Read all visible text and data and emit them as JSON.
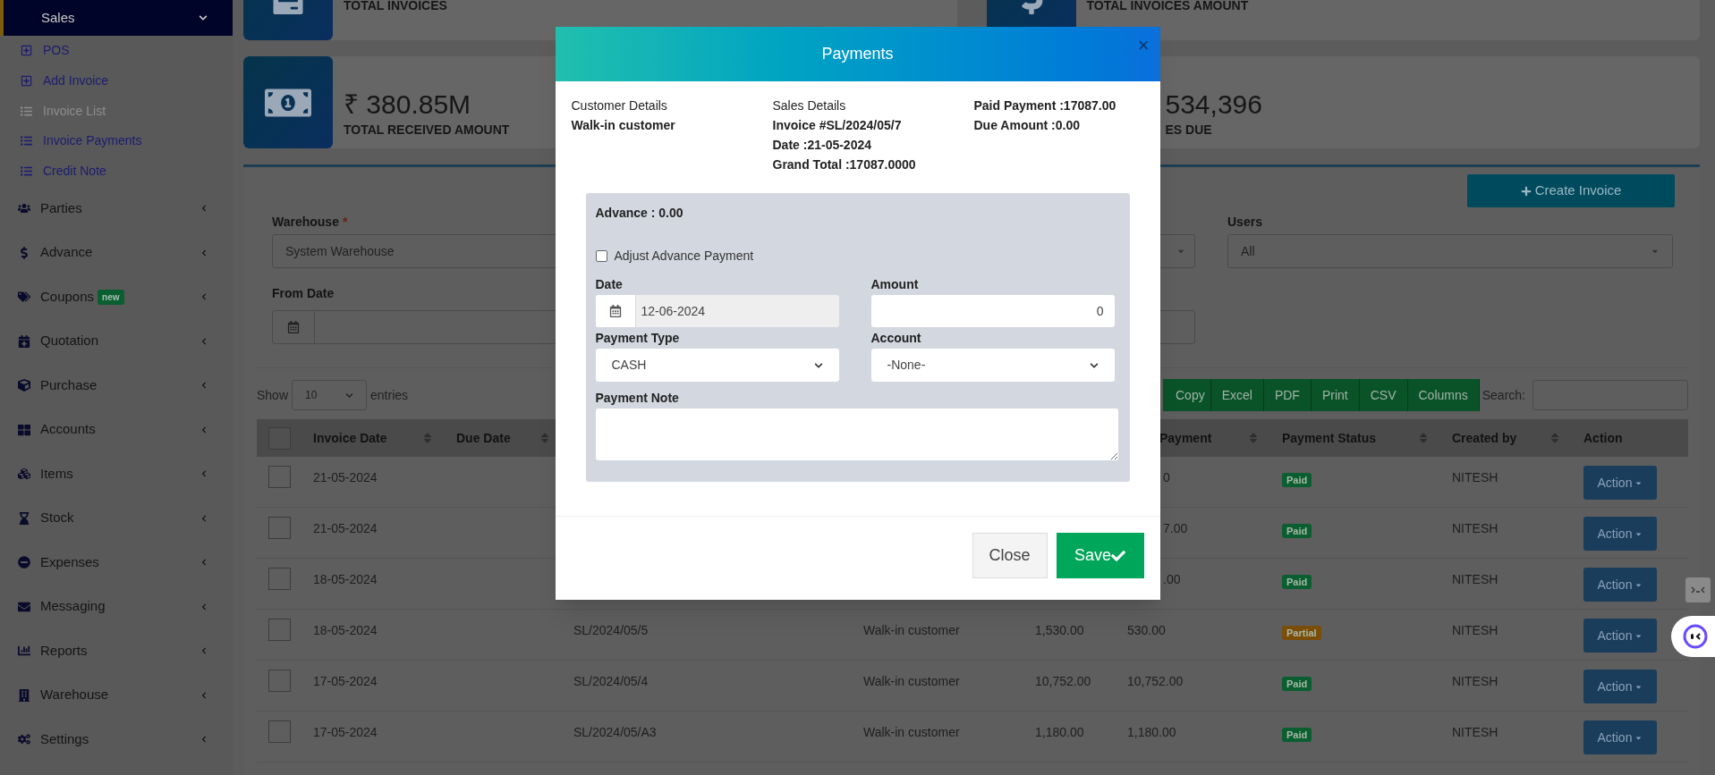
{
  "sidebar": {
    "section": {
      "label": "Sales",
      "expanded": true
    },
    "sub_items": [
      {
        "label": "POS",
        "selected": false
      },
      {
        "label": "Add Invoice",
        "selected": false
      },
      {
        "label": "Invoice List",
        "selected": true
      },
      {
        "label": "Invoice Payments",
        "selected": false
      },
      {
        "label": "Credit Note",
        "selected": false
      }
    ],
    "items": [
      {
        "label": "Parties",
        "expanded": false
      },
      {
        "label": "Advance",
        "expanded": false
      },
      {
        "label": "Coupons",
        "badge": "new",
        "expanded": false
      },
      {
        "label": "Quotation",
        "expanded": false
      },
      {
        "label": "Purchase",
        "expanded": false
      },
      {
        "label": "Accounts",
        "expanded": false
      },
      {
        "label": "Items",
        "expanded": false
      },
      {
        "label": "Stock",
        "expanded": false
      },
      {
        "label": "Expenses",
        "expanded": false
      },
      {
        "label": "Messaging",
        "expanded": false
      },
      {
        "label": "Reports",
        "expanded": false
      },
      {
        "label": "Warehouse",
        "expanded": false
      },
      {
        "label": "Settings",
        "expanded": false
      }
    ]
  },
  "stats_top": [
    {
      "label": "TOTAL INVOICES"
    },
    {
      "label": "TOTAL INVOICES AMOUNT"
    }
  ],
  "stats": [
    {
      "value": "₹ 380.85M",
      "label": "TOTAL RECEIVED AMOUNT"
    },
    {
      "value": "534,396",
      "label": "ES DUE"
    }
  ],
  "create_button": "Create Invoice",
  "filters": {
    "warehouse": {
      "label": "Warehouse",
      "required_mark": "*",
      "value": "System Warehouse"
    },
    "from_date": {
      "label": "From Date"
    },
    "users": {
      "label": "Users",
      "value": "All"
    }
  },
  "length": {
    "show": "Show",
    "value": "10",
    "entries": "entries"
  },
  "export_buttons": [
    "Copy",
    "Excel",
    "PDF",
    "Print",
    "CSV",
    "Columns"
  ],
  "search": {
    "label": "Search:"
  },
  "table": {
    "select_all_checked": false,
    "columns": [
      {
        "label": "Invoice Date",
        "sortable": true
      },
      {
        "label": "Due Date",
        "sortable": true
      },
      {
        "label": "Payment",
        "sortable": true
      },
      {
        "label": "Payment Status",
        "sortable": true
      },
      {
        "label": "Created by",
        "sortable": true
      },
      {
        "label": "Action",
        "sortable": false
      }
    ],
    "rows": [
      {
        "selected": false,
        "invoice_date": "21-05-2024",
        "paid": "0",
        "status": {
          "label": "Paid",
          "color": "#0b5e30"
        },
        "created_by": "NITESH",
        "action": "Action"
      },
      {
        "selected": false,
        "invoice_date": "21-05-2024",
        "paid": "7.00",
        "status": {
          "label": "Paid",
          "color": "#0b5e30"
        },
        "created_by": "NITESH",
        "action": "Action"
      },
      {
        "selected": false,
        "invoice_date": "18-05-2024",
        "paid": ".00",
        "status": {
          "label": "Paid",
          "color": "#0b5e30"
        },
        "created_by": "NITESH",
        "action": "Action"
      },
      {
        "selected": false,
        "invoice_date": "18-05-2024",
        "invoice_no": "SL/2024/05/5",
        "customer": "Walk-in customer",
        "total": "1,530.00",
        "paid": "530.00",
        "status": {
          "label": "Partial",
          "color": "#7a4e08"
        },
        "created_by": "NITESH",
        "action": "Action"
      },
      {
        "selected": false,
        "invoice_date": "17-05-2024",
        "invoice_no": "SL/2024/05/4",
        "customer": "Walk-in customer",
        "total": "10,752.00",
        "paid": "10,752.00",
        "status": {
          "label": "Paid",
          "color": "#0b5e30"
        },
        "created_by": "NITESH",
        "action": "Action"
      },
      {
        "selected": false,
        "invoice_date": "17-05-2024",
        "invoice_no": "SL/2024/05/A3",
        "customer": "Walk-in customer",
        "total": "1,180.00",
        "paid": "1,180.00",
        "status": {
          "label": "Paid",
          "color": "#0b5e30"
        },
        "created_by": "NITESH",
        "action": "Action"
      }
    ]
  },
  "modal": {
    "title": "Payments",
    "close": "×",
    "customer": {
      "heading": "Customer Details",
      "name": "Walk-in customer"
    },
    "sales": {
      "heading": "Sales Details",
      "lines": [
        "Invoice #SL/2024/05/7",
        "Date :21-05-2024",
        "Grand Total :17087.0000"
      ]
    },
    "payment_lines": [
      "Paid Payment :17087.00",
      "Due Amount :0.00"
    ],
    "advance": "Advance : 0.00",
    "adjust": {
      "label": "Adjust Advance Payment",
      "checked": false
    },
    "date": {
      "label": "Date",
      "value": "12-06-2024"
    },
    "amount": {
      "label": "Amount",
      "value": "0"
    },
    "payment_type": {
      "label": "Payment Type",
      "value": "CASH"
    },
    "account": {
      "label": "Account",
      "value": "-None-"
    },
    "note": {
      "label": "Payment Note"
    },
    "close_button": "Close",
    "save_button": "Save"
  }
}
